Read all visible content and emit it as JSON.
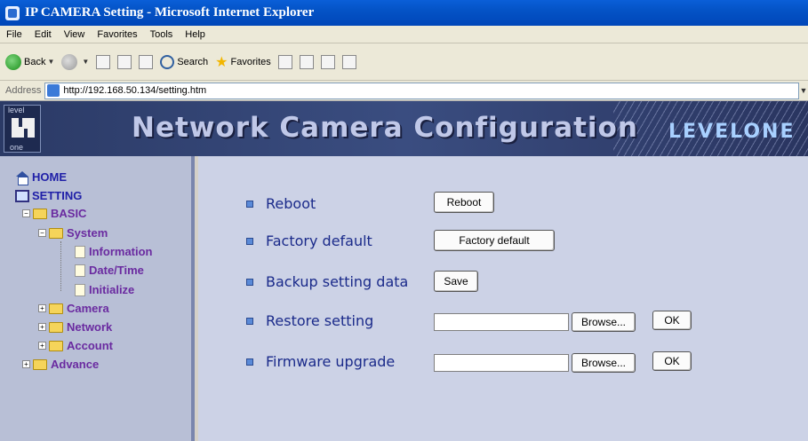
{
  "window": {
    "title": "IP CAMERA Setting - Microsoft Internet Explorer"
  },
  "menu": [
    "File",
    "Edit",
    "View",
    "Favorites",
    "Tools",
    "Help"
  ],
  "toolbar": {
    "back": "Back",
    "search": "Search",
    "favorites": "Favorites"
  },
  "address": {
    "label": "Address",
    "url": "http://192.168.50.134/setting.htm"
  },
  "banner": {
    "title": "Network Camera Configuration",
    "brand": "LEVELONE",
    "logo_top": "level",
    "logo_bottom": "one"
  },
  "sidebar": {
    "home": "HOME",
    "setting": "SETTING",
    "basic": "BASIC",
    "system": "System",
    "information": "Information",
    "datetime": "Date/Time",
    "initialize": "Initialize",
    "camera": "Camera",
    "network": "Network",
    "account": "Account",
    "advance": "Advance"
  },
  "settings": {
    "reboot": {
      "label": "Reboot",
      "button": "Reboot"
    },
    "factory": {
      "label": "Factory default",
      "button": "Factory default"
    },
    "backup": {
      "label": "Backup setting data",
      "button": "Save"
    },
    "restore": {
      "label": "Restore setting",
      "browse": "Browse...",
      "ok": "OK"
    },
    "firmware": {
      "label": "Firmware upgrade",
      "browse": "Browse...",
      "ok": "OK"
    }
  }
}
